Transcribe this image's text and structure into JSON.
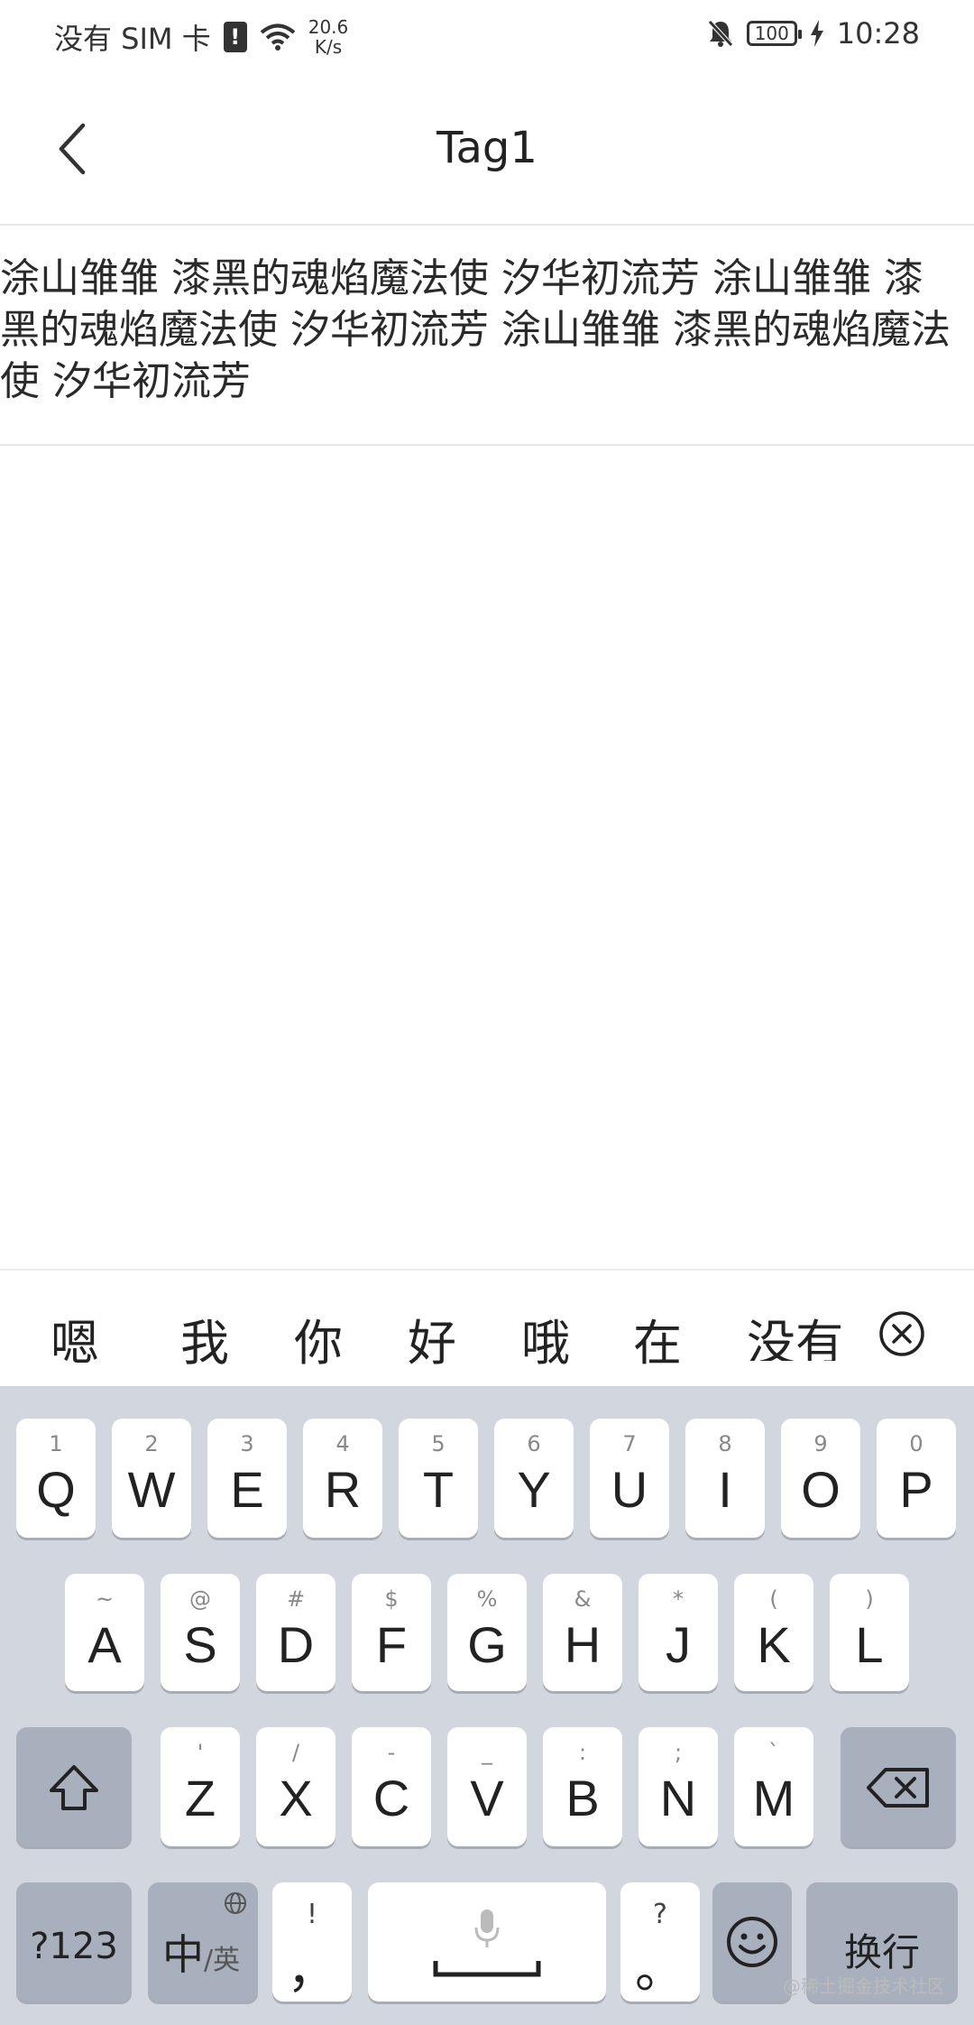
{
  "status_bar": {
    "carrier": "没有 SIM 卡",
    "sim_alert": "!",
    "speed_value": "20.6",
    "speed_unit": "K/s",
    "battery": "100",
    "time": "10:28"
  },
  "app_bar": {
    "title": "Tag1"
  },
  "content": {
    "text": "涂山雏雏 漆黑的魂焰魔法使 汐华初流芳 涂山雏雏 漆黑的魂焰魔法使 汐华初流芳 涂山雏雏 漆黑的魂焰魔法使 汐华初流芳"
  },
  "candidates": {
    "items": [
      "嗯",
      "我",
      "你",
      "好",
      "哦",
      "在"
    ],
    "clipped": "没有"
  },
  "keyboard": {
    "row1": [
      {
        "main": "Q",
        "sub": "1"
      },
      {
        "main": "W",
        "sub": "2"
      },
      {
        "main": "E",
        "sub": "3"
      },
      {
        "main": "R",
        "sub": "4"
      },
      {
        "main": "T",
        "sub": "5"
      },
      {
        "main": "Y",
        "sub": "6"
      },
      {
        "main": "U",
        "sub": "7"
      },
      {
        "main": "I",
        "sub": "8"
      },
      {
        "main": "O",
        "sub": "9"
      },
      {
        "main": "P",
        "sub": "0"
      }
    ],
    "row2": [
      {
        "main": "A",
        "sub": "~"
      },
      {
        "main": "S",
        "sub": "@"
      },
      {
        "main": "D",
        "sub": "#"
      },
      {
        "main": "F",
        "sub": "$"
      },
      {
        "main": "G",
        "sub": "%"
      },
      {
        "main": "H",
        "sub": "&"
      },
      {
        "main": "J",
        "sub": "*"
      },
      {
        "main": "K",
        "sub": "("
      },
      {
        "main": "L",
        "sub": ")"
      }
    ],
    "row3": [
      {
        "main": "Z",
        "sub": "'"
      },
      {
        "main": "X",
        "sub": "/"
      },
      {
        "main": "C",
        "sub": "-"
      },
      {
        "main": "V",
        "sub": "_"
      },
      {
        "main": "B",
        "sub": ":"
      },
      {
        "main": "N",
        "sub": ";"
      },
      {
        "main": "M",
        "sub": "`"
      }
    ],
    "num_key": "?123",
    "lang_main": "中",
    "lang_sub": "/英",
    "comma_main": "，",
    "comma_sub": "!",
    "period_main": "。",
    "period_sub": "?",
    "enter": "换行"
  },
  "watermark": "@稀土掘金技术社区",
  "colors": {
    "keyboard_bg": "#d2d6de",
    "function_key": "#a9b0bd",
    "key": "#ffffff"
  }
}
